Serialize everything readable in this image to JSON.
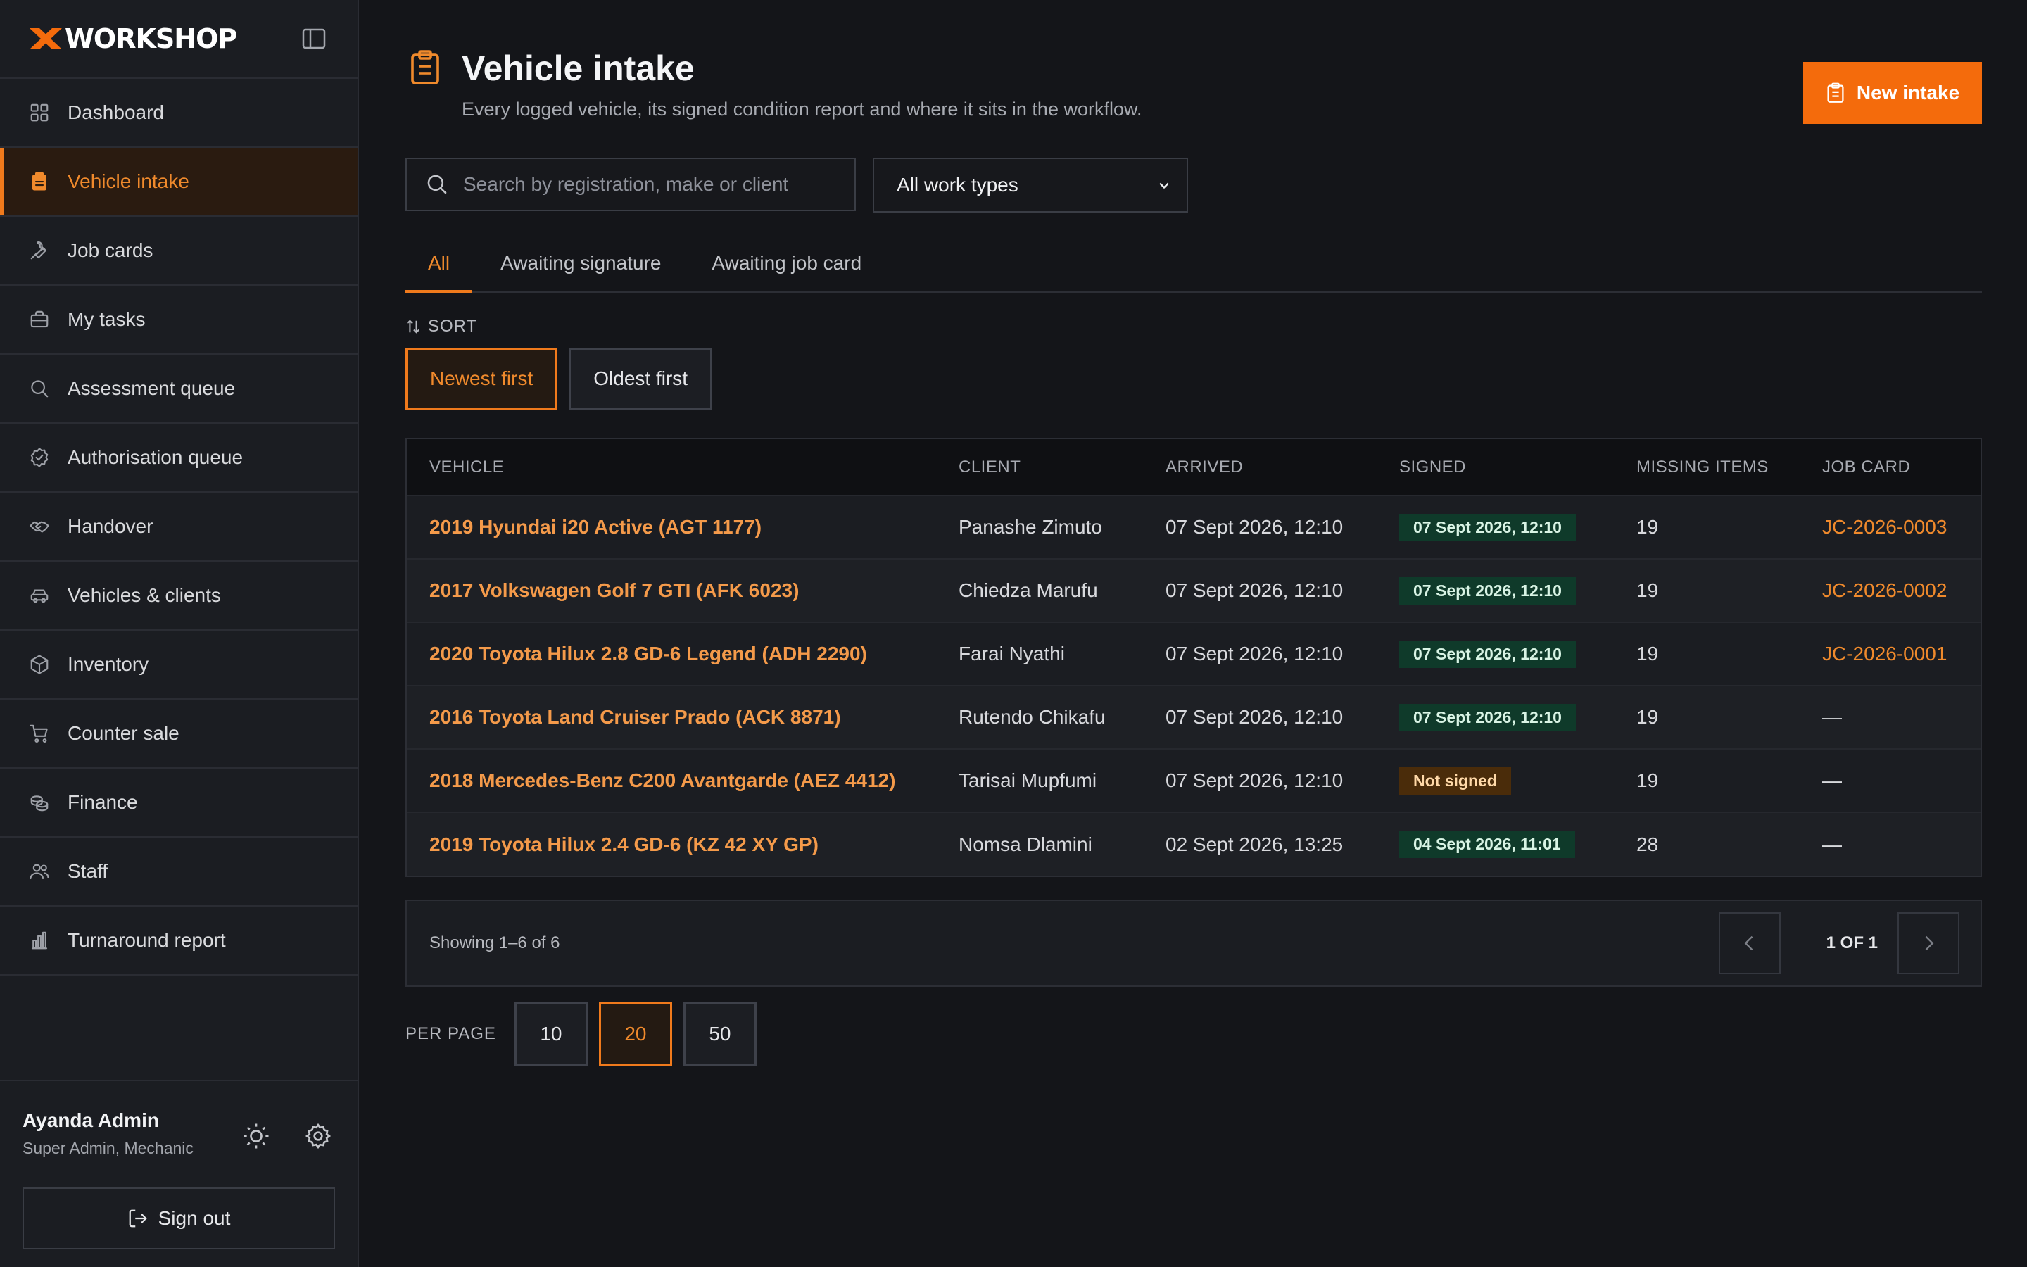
{
  "brand": {
    "logo_text": "WORKSHOP"
  },
  "sidebar": {
    "items": [
      {
        "label": "Dashboard",
        "icon": "grid-icon"
      },
      {
        "label": "Vehicle intake",
        "icon": "clipboard-icon",
        "active": true
      },
      {
        "label": "Job cards",
        "icon": "wrench-icon"
      },
      {
        "label": "My tasks",
        "icon": "briefcase-icon"
      },
      {
        "label": "Assessment queue",
        "icon": "search-icon"
      },
      {
        "label": "Authorisation queue",
        "icon": "badge-check-icon"
      },
      {
        "label": "Handover",
        "icon": "handshake-icon"
      },
      {
        "label": "Vehicles & clients",
        "icon": "car-icon"
      },
      {
        "label": "Inventory",
        "icon": "box-icon"
      },
      {
        "label": "Counter sale",
        "icon": "cart-icon"
      },
      {
        "label": "Finance",
        "icon": "coins-icon"
      },
      {
        "label": "Staff",
        "icon": "users-icon"
      },
      {
        "label": "Turnaround report",
        "icon": "bar-chart-icon"
      }
    ]
  },
  "user": {
    "name": "Ayanda Admin",
    "role": "Super Admin, Mechanic",
    "signout_label": "Sign out"
  },
  "header": {
    "title": "Vehicle intake",
    "subtitle": "Every logged vehicle, its signed condition report and where it sits in the workflow.",
    "new_button": "New intake"
  },
  "filters": {
    "search_placeholder": "Search by registration, make or client",
    "work_type": "All work types"
  },
  "tabs": [
    "All",
    "Awaiting signature",
    "Awaiting job card"
  ],
  "sort": {
    "label": "SORT",
    "options": [
      "Newest first",
      "Oldest first"
    ],
    "active": 0
  },
  "table": {
    "headers": [
      "VEHICLE",
      "CLIENT",
      "ARRIVED",
      "SIGNED",
      "MISSING ITEMS",
      "JOB CARD"
    ],
    "rows": [
      {
        "vehicle": "2019 Hyundai i20 Active (AGT 1177)",
        "client": "Panashe Zimuto",
        "arrived": "07 Sept 2026, 12:10",
        "signed": "07 Sept 2026, 12:10",
        "signed_ok": true,
        "missing": "19",
        "job_card": "JC-2026-0003"
      },
      {
        "vehicle": "2017 Volkswagen Golf 7 GTI (AFK 6023)",
        "client": "Chiedza Marufu",
        "arrived": "07 Sept 2026, 12:10",
        "signed": "07 Sept 2026, 12:10",
        "signed_ok": true,
        "missing": "19",
        "job_card": "JC-2026-0002"
      },
      {
        "vehicle": "2020 Toyota Hilux 2.8 GD-6 Legend (ADH 2290)",
        "client": "Farai Nyathi",
        "arrived": "07 Sept 2026, 12:10",
        "signed": "07 Sept 2026, 12:10",
        "signed_ok": true,
        "missing": "19",
        "job_card": "JC-2026-0001"
      },
      {
        "vehicle": "2016 Toyota Land Cruiser Prado (ACK 8871)",
        "client": "Rutendo Chikafu",
        "arrived": "07 Sept 2026, 12:10",
        "signed": "07 Sept 2026, 12:10",
        "signed_ok": true,
        "missing": "19",
        "job_card": "—"
      },
      {
        "vehicle": "2018 Mercedes-Benz C200 Avantgarde (AEZ 4412)",
        "client": "Tarisai Mupfumi",
        "arrived": "07 Sept 2026, 12:10",
        "signed": "Not signed",
        "signed_ok": false,
        "missing": "19",
        "job_card": "—"
      },
      {
        "vehicle": "2019 Toyota Hilux 2.4 GD-6 (KZ 42 XY GP)",
        "client": "Nomsa Dlamini",
        "arrived": "02 Sept 2026, 13:25",
        "signed": "04 Sept 2026, 11:01",
        "signed_ok": true,
        "missing": "28",
        "job_card": "—"
      }
    ]
  },
  "pagination": {
    "showing": "Showing 1–6 of 6",
    "page_info": "1 OF 1"
  },
  "per_page": {
    "label": "PER PAGE",
    "options": [
      "10",
      "20",
      "50"
    ],
    "active": 1
  },
  "colors": {
    "accent": "#f46b0c",
    "signed_ok_bg": "#0f3a2a",
    "not_signed_bg": "#4a2c0a"
  }
}
